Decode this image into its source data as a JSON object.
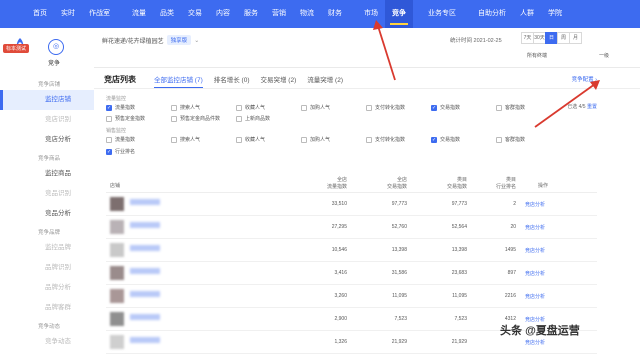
{
  "topnav": {
    "items": [
      {
        "label": "首页"
      },
      {
        "label": "实时"
      },
      {
        "label": "作战室"
      },
      {
        "label": "流量"
      },
      {
        "label": "品类"
      },
      {
        "label": "交易"
      },
      {
        "label": "内容"
      },
      {
        "label": "服务"
      },
      {
        "label": "营销"
      },
      {
        "label": "物流"
      },
      {
        "label": "财务"
      },
      {
        "label": "市场"
      },
      {
        "label": "竞争"
      },
      {
        "label": "业务专区"
      },
      {
        "label": "自助分析"
      },
      {
        "label": "人群"
      },
      {
        "label": "学院"
      }
    ],
    "active_index": 12
  },
  "sidebar": {
    "badge": "标本测试",
    "shop_name": "竞争",
    "menu": [
      {
        "type": "group",
        "label": "竞争店铺"
      },
      {
        "type": "item",
        "label": "监控店铺",
        "state": "active"
      },
      {
        "type": "item",
        "label": "竞店识别",
        "state": "dim"
      },
      {
        "type": "item",
        "label": "竞店分析",
        "state": "normal"
      },
      {
        "type": "group",
        "label": "竞争商品"
      },
      {
        "type": "item",
        "label": "监控商品",
        "state": "normal"
      },
      {
        "type": "item",
        "label": "竞品识别",
        "state": "dim"
      },
      {
        "type": "item",
        "label": "竞品分析",
        "state": "normal"
      },
      {
        "type": "group",
        "label": "竞争品牌"
      },
      {
        "type": "item",
        "label": "监控品牌",
        "state": "dim"
      },
      {
        "type": "item",
        "label": "品牌识别",
        "state": "dim"
      },
      {
        "type": "item",
        "label": "品牌分析",
        "state": "dim"
      },
      {
        "type": "item",
        "label": "品牌客群",
        "state": "dim"
      },
      {
        "type": "group",
        "label": "竞争动态"
      },
      {
        "type": "item",
        "label": "竞争动态",
        "state": "dim"
      }
    ]
  },
  "filterbar": {
    "category": "鲜花速递/花卉绿植园艺",
    "tag": "独享版",
    "date": "统计时间 2021-02-25",
    "ranges": [
      "7天",
      "30天",
      "日",
      "周",
      "月"
    ],
    "active_range": 2,
    "terminal": "所有终端",
    "terminal_level": "一级"
  },
  "panel": {
    "title": "竞店列表",
    "tabs": [
      {
        "label": "全部监控店铺 (7)"
      },
      {
        "label": "排名增长 (0)"
      },
      {
        "label": "交易突增 (2)"
      },
      {
        "label": "流量突增 (2)"
      }
    ],
    "active_tab": 0,
    "config_link": "竞争配置",
    "picked_text": "已选 4/5",
    "reset": "重置",
    "section1_label": "流量监控",
    "section2_label": "销售监控",
    "row1": [
      {
        "label": "流量指数",
        "checked": true
      },
      {
        "label": "搜索人气",
        "checked": false
      },
      {
        "label": "收藏人气",
        "checked": false
      },
      {
        "label": "加购人气",
        "checked": false
      },
      {
        "label": "支付转化指数",
        "checked": false
      },
      {
        "label": "交易指数",
        "checked": true
      },
      {
        "label": "客群指数",
        "checked": false
      }
    ],
    "row2": [
      {
        "label": "预售定金指数",
        "checked": false
      },
      {
        "label": "预售定金商品件数",
        "checked": false
      },
      {
        "label": "上新商品数",
        "checked": false
      }
    ],
    "row3": [
      {
        "label": "流量指数",
        "checked": false
      },
      {
        "label": "搜索人气",
        "checked": false
      },
      {
        "label": "收藏人气",
        "checked": false
      },
      {
        "label": "加购人气",
        "checked": false
      },
      {
        "label": "支付转化指数",
        "checked": false
      },
      {
        "label": "交易指数",
        "checked": true
      },
      {
        "label": "客群指数",
        "checked": false
      }
    ],
    "row4": [
      {
        "label": "行业排名",
        "checked": true
      }
    ],
    "columns": [
      "店铺",
      "全店\n流量指数",
      "全店\n交易指数",
      "类目\n交易指数",
      "类目\n行业排名",
      "操作"
    ],
    "rows": [
      {
        "c1": "33,510",
        "c2": "97,773",
        "c3": "97,773",
        "c4": "2",
        "op": "竞店分析"
      },
      {
        "c1": "27,295",
        "c2": "52,760",
        "c3": "52,564",
        "c4": "20",
        "op": "竞店分析"
      },
      {
        "c1": "10,546",
        "c2": "13,398",
        "c3": "13,398",
        "c4": "1495",
        "op": "竞店分析"
      },
      {
        "c1": "3,416",
        "c2": "31,586",
        "c3": "23,683",
        "c4": "897",
        "op": "竞店分析"
      },
      {
        "c1": "3,260",
        "c2": "11,095",
        "c3": "11,095",
        "c4": "2216",
        "op": "竞店分析"
      },
      {
        "c1": "2,900",
        "c2": "7,523",
        "c3": "7,523",
        "c4": "4312",
        "op": "竞店分析"
      },
      {
        "c1": "1,326",
        "c2": "21,929",
        "c3": "21,929",
        "c4": "",
        "op": "竞店分析"
      }
    ]
  },
  "watermark": {
    "prefix": "头条",
    "text": "@夏盘运营"
  },
  "colors": {
    "primary": "#3d6bf0",
    "arrow": "#d93a2f"
  }
}
